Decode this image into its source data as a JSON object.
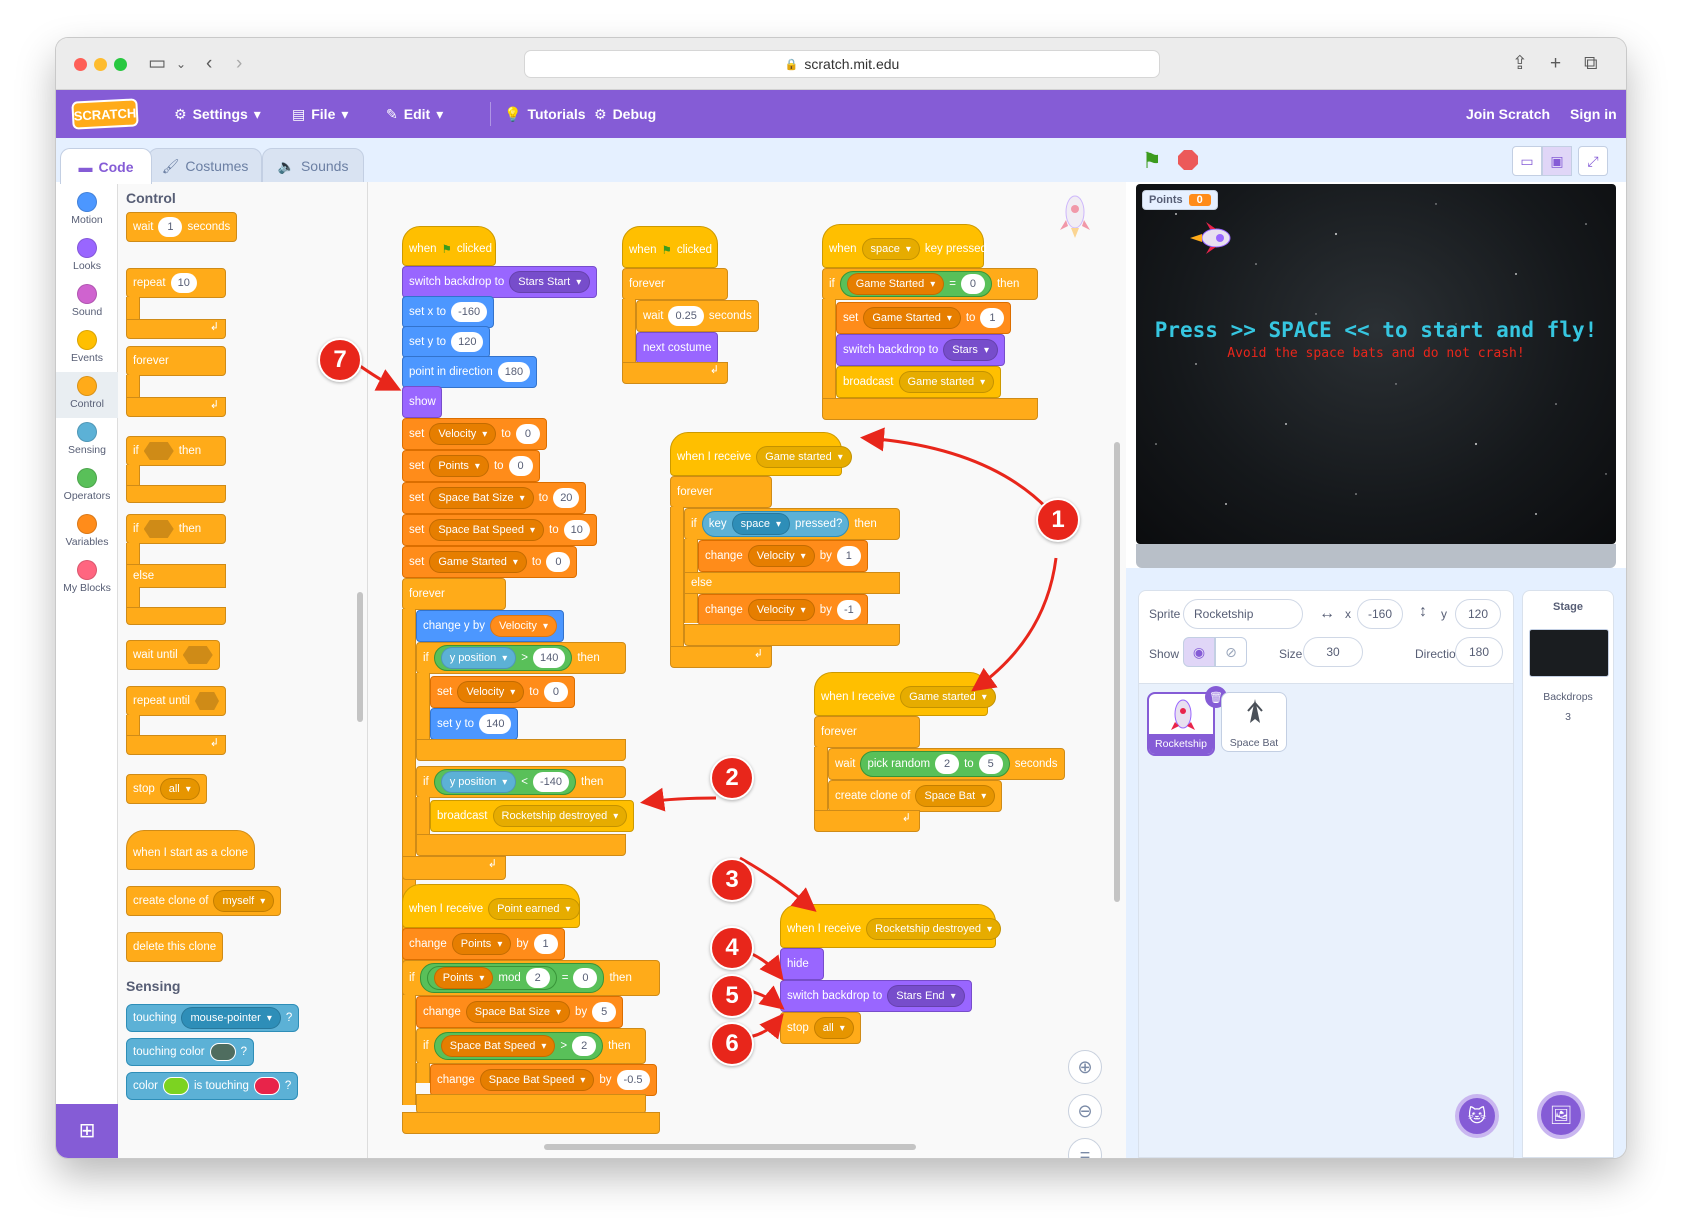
{
  "browser": {
    "url": "scratch.mit.edu"
  },
  "menu": {
    "logo": "SCRATCH",
    "settings": "Settings",
    "file": "File",
    "edit": "Edit",
    "tutorials": "Tutorials",
    "debug": "Debug",
    "join": "Join Scratch",
    "signin": "Sign in"
  },
  "tabs": {
    "code": "Code",
    "costumes": "Costumes",
    "sounds": "Sounds"
  },
  "categories": [
    {
      "label": "Motion",
      "color": "#4c97ff"
    },
    {
      "label": "Looks",
      "color": "#9966ff"
    },
    {
      "label": "Sound",
      "color": "#cf63cf"
    },
    {
      "label": "Events",
      "color": "#ffbf00"
    },
    {
      "label": "Control",
      "color": "#ffab19"
    },
    {
      "label": "Sensing",
      "color": "#5cb1d6"
    },
    {
      "label": "Operators",
      "color": "#59c059"
    },
    {
      "label": "Variables",
      "color": "#ff8c1a"
    },
    {
      "label": "My Blocks",
      "color": "#ff6680"
    }
  ],
  "palette": {
    "control_heading": "Control",
    "wait": "wait",
    "wait_val": "1",
    "seconds": "seconds",
    "repeat": "repeat",
    "repeat_val": "10",
    "forever": "forever",
    "if": "if",
    "then": "then",
    "else": "else",
    "wait_until": "wait until",
    "repeat_until": "repeat until",
    "stop": "stop",
    "stop_val": "all",
    "start_clone": "when I start as a clone",
    "create_clone": "create clone of",
    "myself": "myself",
    "delete_clone": "delete this clone",
    "sensing_heading": "Sensing",
    "touching": "touching",
    "mouse_pointer": "mouse-pointer",
    "q": "?",
    "touching_color": "touching color",
    "color": "color",
    "is_touching": "is touching"
  },
  "script1": {
    "when": "when",
    "clicked": "clicked",
    "switch_backdrop": "switch backdrop to",
    "stars_start": "Stars Start",
    "set_x": "set x to",
    "x_val": "-160",
    "set_y": "set y to",
    "y_val": "120",
    "point_dir": "point in direction",
    "dir_val": "180",
    "show": "show",
    "set": "set",
    "to": "to",
    "velocity": "Velocity",
    "v0": "0",
    "points": "Points",
    "p0": "0",
    "bat_size": "Space Bat Size",
    "bs": "20",
    "bat_speed": "Space Bat Speed",
    "bsp": "10",
    "game_started": "Game Started",
    "gs0": "0",
    "forever": "forever",
    "change_y": "change y by",
    "if": "if",
    "then": "then",
    "y_position": "y position",
    "gt": ">",
    "lt": "<",
    "y140": "140",
    "yneg140": "-140",
    "v_zero": "0",
    "set_y2": "set y to",
    "y2": "140",
    "broadcast": "broadcast",
    "destroyed": "Rocketship destroyed"
  },
  "script2": {
    "when": "when",
    "clicked": "clicked",
    "forever": "forever",
    "wait": "wait",
    "wait_val": "0.25",
    "seconds": "seconds",
    "next_costume": "next costume"
  },
  "script3": {
    "when": "when",
    "space": "space",
    "key_pressed": "key pressed",
    "if": "if",
    "then": "then",
    "game_started": "Game Started",
    "eq": "=",
    "zero": "0",
    "set": "set",
    "to": "to",
    "one": "1",
    "switch_backdrop": "switch backdrop to",
    "stars": "Stars",
    "broadcast": "broadcast",
    "gs_msg": "Game started"
  },
  "script4": {
    "when_receive": "when I receive",
    "msg": "Game started",
    "forever": "forever",
    "if": "if",
    "key": "key",
    "space": "space",
    "pressed": "pressed?",
    "then": "then",
    "change": "change",
    "velocity": "Velocity",
    "by": "by",
    "v1": "1",
    "else": "else",
    "vneg1": "-1"
  },
  "script5": {
    "when_receive": "when I receive",
    "msg": "Game started",
    "forever": "forever",
    "wait": "wait",
    "pick_random": "pick random",
    "r1": "2",
    "to": "to",
    "r2": "5",
    "seconds": "seconds",
    "create_clone": "create clone of",
    "space_bat": "Space Bat"
  },
  "script6": {
    "when_receive": "when I receive",
    "msg": "Point earned",
    "change": "change",
    "points": "Points",
    "by": "by",
    "one": "1",
    "if": "if",
    "mod": "mod",
    "two": "2",
    "eq": "=",
    "zero": "0",
    "then": "then",
    "bat_size": "Space Bat Size",
    "five": "5",
    "gt": ">",
    "bat_speed": "Space Bat Speed",
    "neg05": "-0.5"
  },
  "script7": {
    "when_receive": "when I receive",
    "msg": "Rocketship destroyed",
    "hide": "hide",
    "switch_backdrop": "switch backdrop to",
    "stars_end": "Stars End",
    "stop": "stop",
    "all": "all"
  },
  "callouts": [
    "1",
    "2",
    "3",
    "4",
    "5",
    "6",
    "7"
  ],
  "stage": {
    "points_label": "Points",
    "points_val": "0",
    "title": "Press >> SPACE << to start and fly!",
    "subtitle": "Avoid the space bats and do not crash!"
  },
  "sprite": {
    "label": "Sprite",
    "name": "Rocketship",
    "x_label": "x",
    "x": "-160",
    "y_label": "y",
    "y": "120",
    "show": "Show",
    "size_label": "Size",
    "size": "30",
    "dir_label": "Direction",
    "dir": "180"
  },
  "sprites": [
    {
      "name": "Rocketship"
    },
    {
      "name": "Space Bat"
    }
  ],
  "stage_panel": {
    "title": "Stage",
    "backdrops": "Backdrops",
    "count": "3"
  }
}
